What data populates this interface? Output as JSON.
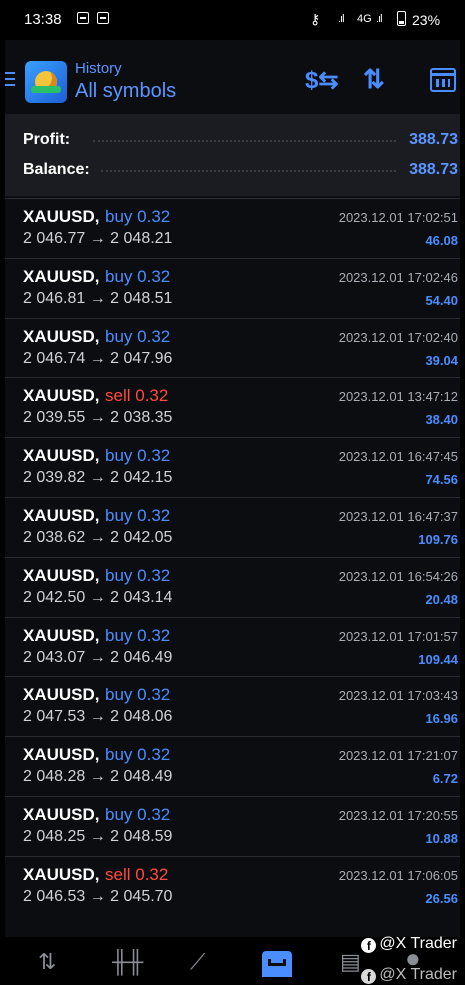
{
  "status_bar": {
    "time": "13:38",
    "network": "4G",
    "battery": "23%"
  },
  "header": {
    "subtitle": "History",
    "title": "All symbols"
  },
  "toolbar": {
    "icons": [
      "currency-filter-icon",
      "sort-icon",
      "calendar-icon"
    ]
  },
  "summary": {
    "profit_label": "Profit:",
    "profit_value": "388.73",
    "balance_label": "Balance:",
    "balance_value": "388.73"
  },
  "deals": [
    {
      "symbol": "XAUUSD,",
      "side": "buy",
      "volume": "0.32",
      "prices": "2 046.77 → 2 048.21",
      "time": "2023.12.01 17:02:51",
      "profit": "46.08"
    },
    {
      "symbol": "XAUUSD,",
      "side": "buy",
      "volume": "0.32",
      "prices": "2 046.81 → 2 048.51",
      "time": "2023.12.01 17:02:46",
      "profit": "54.40"
    },
    {
      "symbol": "XAUUSD,",
      "side": "buy",
      "volume": "0.32",
      "prices": "2 046.74 → 2 047.96",
      "time": "2023.12.01 17:02:40",
      "profit": "39.04"
    },
    {
      "symbol": "XAUUSD,",
      "side": "sell",
      "volume": "0.32",
      "prices": "2 039.55 → 2 038.35",
      "time": "2023.12.01 13:47:12",
      "profit": "38.40"
    },
    {
      "symbol": "XAUUSD,",
      "side": "buy",
      "volume": "0.32",
      "prices": "2 039.82 → 2 042.15",
      "time": "2023.12.01 16:47:45",
      "profit": "74.56"
    },
    {
      "symbol": "XAUUSD,",
      "side": "buy",
      "volume": "0.32",
      "prices": "2 038.62 → 2 042.05",
      "time": "2023.12.01 16:47:37",
      "profit": "109.76"
    },
    {
      "symbol": "XAUUSD,",
      "side": "buy",
      "volume": "0.32",
      "prices": "2 042.50 → 2 043.14",
      "time": "2023.12.01 16:54:26",
      "profit": "20.48"
    },
    {
      "symbol": "XAUUSD,",
      "side": "buy",
      "volume": "0.32",
      "prices": "2 043.07 → 2 046.49",
      "time": "2023.12.01 17:01:57",
      "profit": "109.44"
    },
    {
      "symbol": "XAUUSD,",
      "side": "buy",
      "volume": "0.32",
      "prices": "2 047.53 → 2 048.06",
      "time": "2023.12.01 17:03:43",
      "profit": "16.96"
    },
    {
      "symbol": "XAUUSD,",
      "side": "buy",
      "volume": "0.32",
      "prices": "2 048.28 → 2 048.49",
      "time": "2023.12.01 17:21:07",
      "profit": "6.72"
    },
    {
      "symbol": "XAUUSD,",
      "side": "buy",
      "volume": "0.32",
      "prices": "2 048.25 → 2 048.59",
      "time": "2023.12.01 17:20:55",
      "profit": "10.88"
    },
    {
      "symbol": "XAUUSD,",
      "side": "sell",
      "volume": "0.32",
      "prices": "2 046.53 → 2 045.70",
      "time": "2023.12.01 17:06:05",
      "profit": "26.56"
    }
  ],
  "bottom_nav": {
    "items": [
      "quotes-icon",
      "chart-icon",
      "trade-icon",
      "history-icon",
      "news-icon",
      "chat-icon"
    ],
    "active": "history-icon"
  },
  "watermark": {
    "text": "@X Trader"
  },
  "colors": {
    "accent": "#4a8dff",
    "sell": "#ff4a3d",
    "background": "#0c0d10",
    "summary_bg": "#1a1c21"
  }
}
